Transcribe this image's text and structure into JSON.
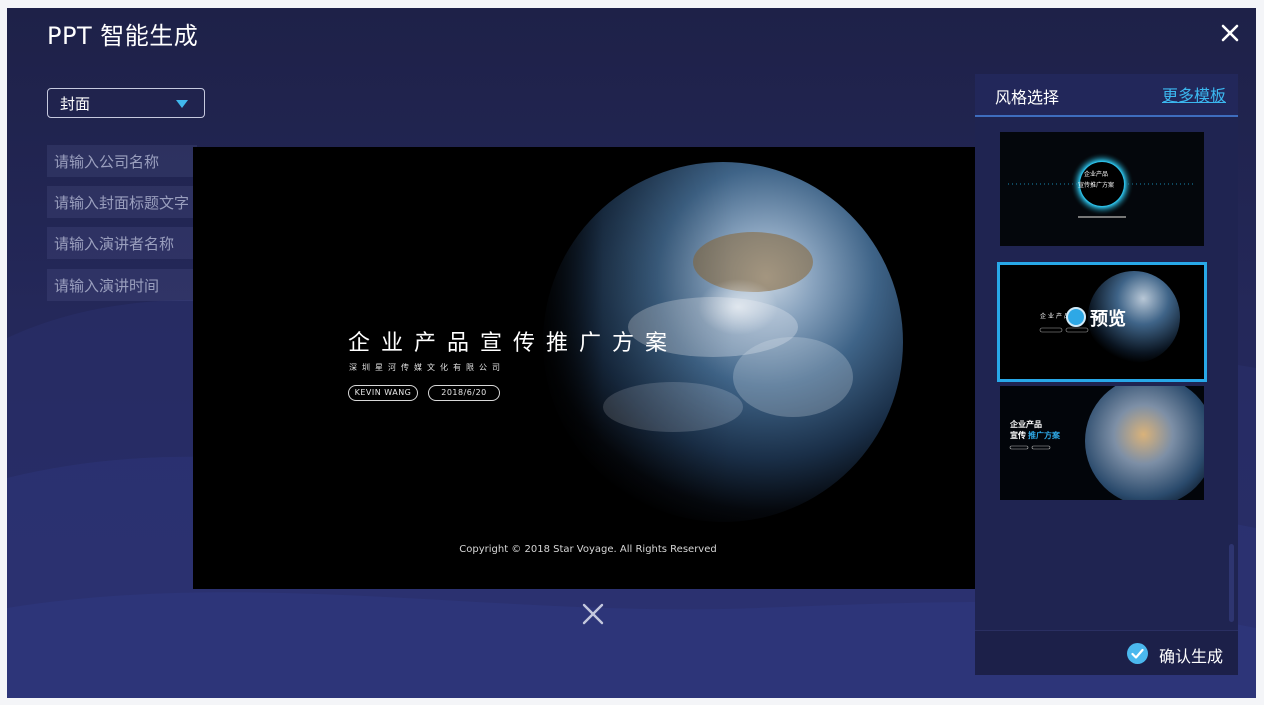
{
  "window": {
    "title": "PPT 智能生成"
  },
  "form": {
    "page_select": "封面",
    "fields": [
      {
        "placeholder": "请输入公司名称"
      },
      {
        "placeholder": "请输入封面标题文字"
      },
      {
        "placeholder": "请输入演讲者名称"
      },
      {
        "placeholder": "请输入演讲时间"
      }
    ]
  },
  "preview": {
    "title": "企业产品宣传推广方案",
    "subtitle": "深圳星河传媒文化有限公司",
    "speaker": "KEVIN WANG",
    "date": "2018/6/20",
    "copyright": "Copyright © 2018 Star Voyage. All Rights Reserved"
  },
  "style_panel": {
    "title": "风格选择",
    "more_link": "更多模板",
    "preview_label": "预览",
    "confirm_label": "确认生成",
    "thumbs": [
      {
        "title_line1": "企业产品",
        "title_line2": "宣传推广方案"
      },
      {
        "title": "企业产品"
      },
      {
        "title_line1": "企业产品",
        "title_line2a": "宣传",
        "title_line2b": "推广方案"
      }
    ]
  },
  "colors": {
    "accent": "#28a8e8",
    "link": "#3bb7ef",
    "background": "#1e2148",
    "panel": "#1f2451"
  }
}
